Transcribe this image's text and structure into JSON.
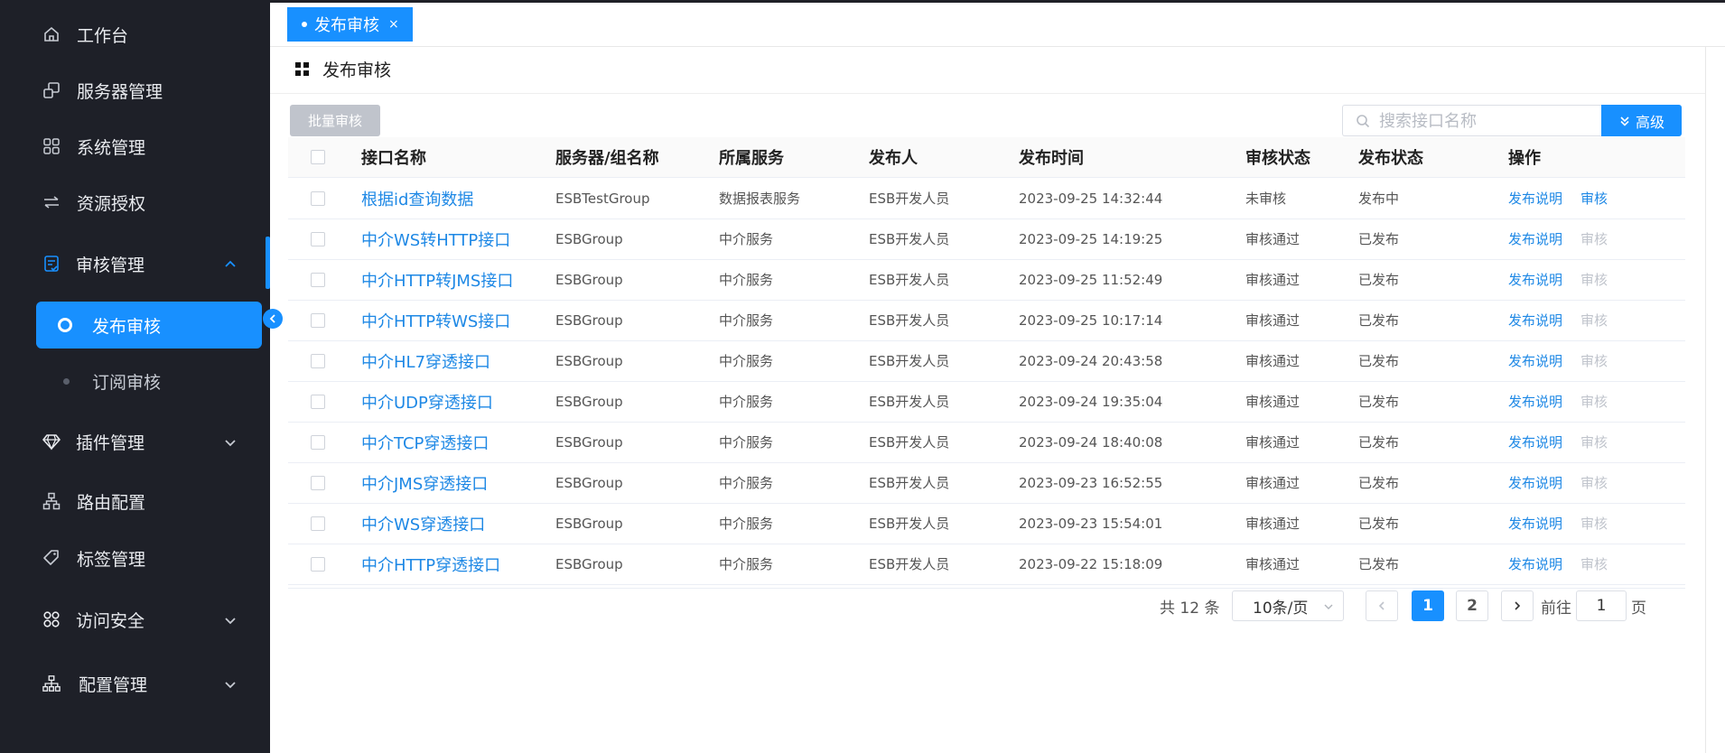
{
  "sidebar": {
    "items": [
      {
        "label": "工作台",
        "icon": "home-icon"
      },
      {
        "label": "服务器管理",
        "icon": "server-icon"
      },
      {
        "label": "系统管理",
        "icon": "apps-icon"
      },
      {
        "label": "资源授权",
        "icon": "swap-icon"
      },
      {
        "label": "审核管理",
        "icon": "audit-icon",
        "expanded": true
      },
      {
        "label": "插件管理",
        "icon": "diamond-icon"
      },
      {
        "label": "路由配置",
        "icon": "route-icon"
      },
      {
        "label": "标签管理",
        "icon": "tag-icon"
      },
      {
        "label": "访问安全",
        "icon": "security-icon"
      },
      {
        "label": "配置管理",
        "icon": "org-icon"
      }
    ],
    "sub_items": [
      {
        "label": "发布审核",
        "active": true
      },
      {
        "label": "订阅审核",
        "active": false
      }
    ]
  },
  "tab": {
    "label": "发布审核",
    "close": "×"
  },
  "page": {
    "title": "发布审核"
  },
  "toolbar": {
    "batch_label": "批量审核",
    "search_placeholder": "搜索接口名称",
    "advanced_label": "高级"
  },
  "table": {
    "headers": [
      "接口名称",
      "服务器/组名称",
      "所属服务",
      "发布人",
      "发布时间",
      "审核状态",
      "发布状态",
      "操作"
    ],
    "rows": [
      {
        "name": "根据id查询数据",
        "group": "ESBTestGroup",
        "service": "数据报表服务",
        "publisher": "ESB开发人员",
        "time": "2023-09-25 14:32:44",
        "audit": "未审核",
        "pub": "发布中",
        "op1": "发布说明",
        "op2": "审核",
        "op2_enabled": true
      },
      {
        "name": "中介WS转HTTP接口",
        "group": "ESBGroup",
        "service": "中介服务",
        "publisher": "ESB开发人员",
        "time": "2023-09-25 14:19:25",
        "audit": "审核通过",
        "pub": "已发布",
        "op1": "发布说明",
        "op2": "审核",
        "op2_enabled": false
      },
      {
        "name": "中介HTTP转JMS接口",
        "group": "ESBGroup",
        "service": "中介服务",
        "publisher": "ESB开发人员",
        "time": "2023-09-25 11:52:49",
        "audit": "审核通过",
        "pub": "已发布",
        "op1": "发布说明",
        "op2": "审核",
        "op2_enabled": false
      },
      {
        "name": "中介HTTP转WS接口",
        "group": "ESBGroup",
        "service": "中介服务",
        "publisher": "ESB开发人员",
        "time": "2023-09-25 10:17:14",
        "audit": "审核通过",
        "pub": "已发布",
        "op1": "发布说明",
        "op2": "审核",
        "op2_enabled": false
      },
      {
        "name": "中介HL7穿透接口",
        "group": "ESBGroup",
        "service": "中介服务",
        "publisher": "ESB开发人员",
        "time": "2023-09-24 20:43:58",
        "audit": "审核通过",
        "pub": "已发布",
        "op1": "发布说明",
        "op2": "审核",
        "op2_enabled": false
      },
      {
        "name": "中介UDP穿透接口",
        "group": "ESBGroup",
        "service": "中介服务",
        "publisher": "ESB开发人员",
        "time": "2023-09-24 19:35:04",
        "audit": "审核通过",
        "pub": "已发布",
        "op1": "发布说明",
        "op2": "审核",
        "op2_enabled": false
      },
      {
        "name": "中介TCP穿透接口",
        "group": "ESBGroup",
        "service": "中介服务",
        "publisher": "ESB开发人员",
        "time": "2023-09-24 18:40:08",
        "audit": "审核通过",
        "pub": "已发布",
        "op1": "发布说明",
        "op2": "审核",
        "op2_enabled": false
      },
      {
        "name": "中介JMS穿透接口",
        "group": "ESBGroup",
        "service": "中介服务",
        "publisher": "ESB开发人员",
        "time": "2023-09-23 16:52:55",
        "audit": "审核通过",
        "pub": "已发布",
        "op1": "发布说明",
        "op2": "审核",
        "op2_enabled": false
      },
      {
        "name": "中介WS穿透接口",
        "group": "ESBGroup",
        "service": "中介服务",
        "publisher": "ESB开发人员",
        "time": "2023-09-23 15:54:01",
        "audit": "审核通过",
        "pub": "已发布",
        "op1": "发布说明",
        "op2": "审核",
        "op2_enabled": false
      },
      {
        "name": "中介HTTP穿透接口",
        "group": "ESBGroup",
        "service": "中介服务",
        "publisher": "ESB开发人员",
        "time": "2023-09-22 15:18:09",
        "audit": "审核通过",
        "pub": "已发布",
        "op1": "发布说明",
        "op2": "审核",
        "op2_enabled": false
      }
    ]
  },
  "pagination": {
    "total": "共 12 条",
    "page_size": "10条/页",
    "prev_icon": "chevron-left-icon",
    "pages": [
      "1",
      "2"
    ],
    "current": "1",
    "next_icon": "chevron-right-icon",
    "goto_label": "前往",
    "goto_value": "1",
    "page_suffix": "页"
  },
  "colors": {
    "accent": "#1890ff",
    "sidebar_bg": "#1e2028",
    "link": "#1e88e5"
  }
}
